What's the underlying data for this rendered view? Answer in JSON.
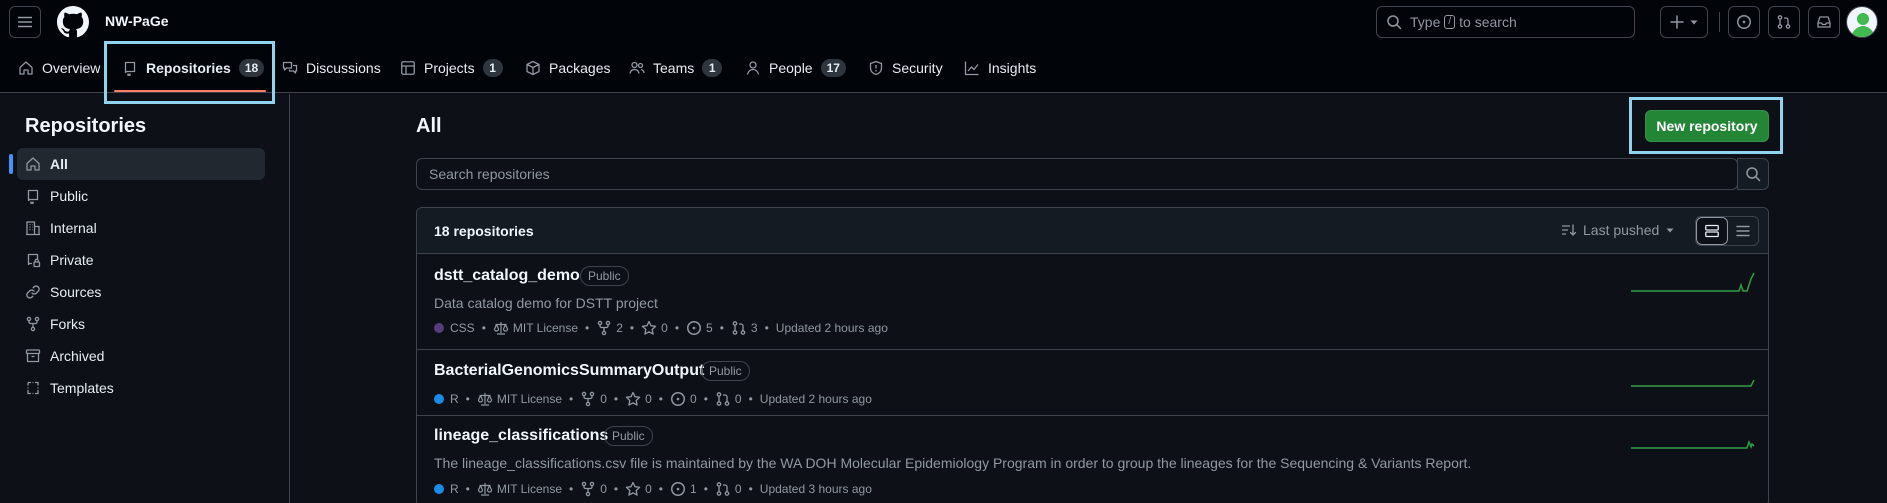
{
  "header": {
    "org_name": "NW-PaGe",
    "search": {
      "prefix": "Type",
      "key": "/",
      "suffix": "to search"
    }
  },
  "nav": {
    "tabs": [
      {
        "label": "Overview"
      },
      {
        "label": "Repositories",
        "count": "18",
        "selected": true
      },
      {
        "label": "Discussions"
      },
      {
        "label": "Projects",
        "count": "1"
      },
      {
        "label": "Packages"
      },
      {
        "label": "Teams",
        "count": "1"
      },
      {
        "label": "People",
        "count": "17"
      },
      {
        "label": "Security"
      },
      {
        "label": "Insights"
      }
    ]
  },
  "sidebar": {
    "title": "Repositories",
    "items": [
      {
        "label": "All",
        "icon": "home-icon",
        "active": true
      },
      {
        "label": "Public",
        "icon": "repo-icon"
      },
      {
        "label": "Internal",
        "icon": "organization-icon"
      },
      {
        "label": "Private",
        "icon": "lock-repo-icon"
      },
      {
        "label": "Sources",
        "icon": "link-icon"
      },
      {
        "label": "Forks",
        "icon": "fork-icon"
      },
      {
        "label": "Archived",
        "icon": "archive-icon"
      },
      {
        "label": "Templates",
        "icon": "template-icon"
      }
    ]
  },
  "main": {
    "title": "All",
    "new_repo_label": "New repository",
    "search_placeholder": "Search repositories",
    "count_label": "18 repositories",
    "sort_label": "Last pushed"
  },
  "repos": [
    {
      "name": "dstt_catalog_demo",
      "visibility": "Public",
      "description": "Data catalog demo for DSTT project",
      "language": "CSS",
      "language_color": "#563d7c",
      "license": "MIT License",
      "forks": "2",
      "stars": "0",
      "issues": "5",
      "pulls": "3",
      "updated": "Updated 2 hours ago"
    },
    {
      "name": "BacterialGenomicsSummaryOutput",
      "visibility": "Public",
      "description": "",
      "language": "R",
      "language_color": "#198ce7",
      "license": "MIT License",
      "forks": "0",
      "stars": "0",
      "issues": "0",
      "pulls": "0",
      "updated": "Updated 2 hours ago"
    },
    {
      "name": "lineage_classifications",
      "visibility": "Public",
      "description": "The lineage_classifications.csv file is maintained by the WA DOH Molecular Epidemiology Program in order to group the lineages for the Sequencing & Variants Report.",
      "language": "R",
      "language_color": "#198ce7",
      "license": "MIT License",
      "forks": "0",
      "stars": "0",
      "issues": "1",
      "pulls": "0",
      "updated": "Updated 3 hours ago"
    }
  ],
  "colors": {
    "accent_underline": "#f78166",
    "primary_button": "#238636",
    "highlight_box": "#8fd3ee",
    "sparkline": "#2ea043"
  }
}
